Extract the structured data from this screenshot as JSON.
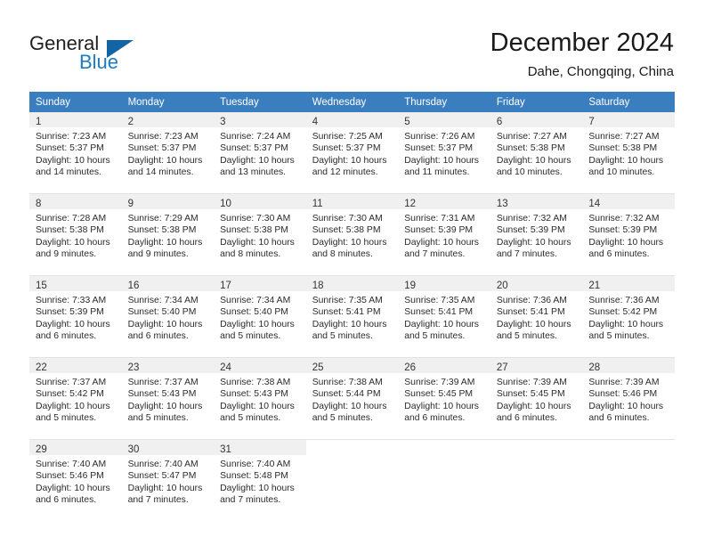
{
  "brand": {
    "name_part1": "General",
    "name_part2": "Blue",
    "logo_icon": "triangle-mark"
  },
  "header": {
    "title": "December 2024",
    "subtitle": "Dahe, Chongqing, China"
  },
  "calendar": {
    "weekday_headers": [
      "Sunday",
      "Monday",
      "Tuesday",
      "Wednesday",
      "Thursday",
      "Friday",
      "Saturday"
    ],
    "header_bg": "#3a7ebf",
    "daynum_bg": "#f0f0f0",
    "weeks": [
      [
        {
          "day": "1",
          "sunrise": "Sunrise: 7:23 AM",
          "sunset": "Sunset: 5:37 PM",
          "daylight1": "Daylight: 10 hours",
          "daylight2": "and 14 minutes."
        },
        {
          "day": "2",
          "sunrise": "Sunrise: 7:23 AM",
          "sunset": "Sunset: 5:37 PM",
          "daylight1": "Daylight: 10 hours",
          "daylight2": "and 14 minutes."
        },
        {
          "day": "3",
          "sunrise": "Sunrise: 7:24 AM",
          "sunset": "Sunset: 5:37 PM",
          "daylight1": "Daylight: 10 hours",
          "daylight2": "and 13 minutes."
        },
        {
          "day": "4",
          "sunrise": "Sunrise: 7:25 AM",
          "sunset": "Sunset: 5:37 PM",
          "daylight1": "Daylight: 10 hours",
          "daylight2": "and 12 minutes."
        },
        {
          "day": "5",
          "sunrise": "Sunrise: 7:26 AM",
          "sunset": "Sunset: 5:37 PM",
          "daylight1": "Daylight: 10 hours",
          "daylight2": "and 11 minutes."
        },
        {
          "day": "6",
          "sunrise": "Sunrise: 7:27 AM",
          "sunset": "Sunset: 5:38 PM",
          "daylight1": "Daylight: 10 hours",
          "daylight2": "and 10 minutes."
        },
        {
          "day": "7",
          "sunrise": "Sunrise: 7:27 AM",
          "sunset": "Sunset: 5:38 PM",
          "daylight1": "Daylight: 10 hours",
          "daylight2": "and 10 minutes."
        }
      ],
      [
        {
          "day": "8",
          "sunrise": "Sunrise: 7:28 AM",
          "sunset": "Sunset: 5:38 PM",
          "daylight1": "Daylight: 10 hours",
          "daylight2": "and 9 minutes."
        },
        {
          "day": "9",
          "sunrise": "Sunrise: 7:29 AM",
          "sunset": "Sunset: 5:38 PM",
          "daylight1": "Daylight: 10 hours",
          "daylight2": "and 9 minutes."
        },
        {
          "day": "10",
          "sunrise": "Sunrise: 7:30 AM",
          "sunset": "Sunset: 5:38 PM",
          "daylight1": "Daylight: 10 hours",
          "daylight2": "and 8 minutes."
        },
        {
          "day": "11",
          "sunrise": "Sunrise: 7:30 AM",
          "sunset": "Sunset: 5:38 PM",
          "daylight1": "Daylight: 10 hours",
          "daylight2": "and 8 minutes."
        },
        {
          "day": "12",
          "sunrise": "Sunrise: 7:31 AM",
          "sunset": "Sunset: 5:39 PM",
          "daylight1": "Daylight: 10 hours",
          "daylight2": "and 7 minutes."
        },
        {
          "day": "13",
          "sunrise": "Sunrise: 7:32 AM",
          "sunset": "Sunset: 5:39 PM",
          "daylight1": "Daylight: 10 hours",
          "daylight2": "and 7 minutes."
        },
        {
          "day": "14",
          "sunrise": "Sunrise: 7:32 AM",
          "sunset": "Sunset: 5:39 PM",
          "daylight1": "Daylight: 10 hours",
          "daylight2": "and 6 minutes."
        }
      ],
      [
        {
          "day": "15",
          "sunrise": "Sunrise: 7:33 AM",
          "sunset": "Sunset: 5:39 PM",
          "daylight1": "Daylight: 10 hours",
          "daylight2": "and 6 minutes."
        },
        {
          "day": "16",
          "sunrise": "Sunrise: 7:34 AM",
          "sunset": "Sunset: 5:40 PM",
          "daylight1": "Daylight: 10 hours",
          "daylight2": "and 6 minutes."
        },
        {
          "day": "17",
          "sunrise": "Sunrise: 7:34 AM",
          "sunset": "Sunset: 5:40 PM",
          "daylight1": "Daylight: 10 hours",
          "daylight2": "and 5 minutes."
        },
        {
          "day": "18",
          "sunrise": "Sunrise: 7:35 AM",
          "sunset": "Sunset: 5:41 PM",
          "daylight1": "Daylight: 10 hours",
          "daylight2": "and 5 minutes."
        },
        {
          "day": "19",
          "sunrise": "Sunrise: 7:35 AM",
          "sunset": "Sunset: 5:41 PM",
          "daylight1": "Daylight: 10 hours",
          "daylight2": "and 5 minutes."
        },
        {
          "day": "20",
          "sunrise": "Sunrise: 7:36 AM",
          "sunset": "Sunset: 5:41 PM",
          "daylight1": "Daylight: 10 hours",
          "daylight2": "and 5 minutes."
        },
        {
          "day": "21",
          "sunrise": "Sunrise: 7:36 AM",
          "sunset": "Sunset: 5:42 PM",
          "daylight1": "Daylight: 10 hours",
          "daylight2": "and 5 minutes."
        }
      ],
      [
        {
          "day": "22",
          "sunrise": "Sunrise: 7:37 AM",
          "sunset": "Sunset: 5:42 PM",
          "daylight1": "Daylight: 10 hours",
          "daylight2": "and 5 minutes."
        },
        {
          "day": "23",
          "sunrise": "Sunrise: 7:37 AM",
          "sunset": "Sunset: 5:43 PM",
          "daylight1": "Daylight: 10 hours",
          "daylight2": "and 5 minutes."
        },
        {
          "day": "24",
          "sunrise": "Sunrise: 7:38 AM",
          "sunset": "Sunset: 5:43 PM",
          "daylight1": "Daylight: 10 hours",
          "daylight2": "and 5 minutes."
        },
        {
          "day": "25",
          "sunrise": "Sunrise: 7:38 AM",
          "sunset": "Sunset: 5:44 PM",
          "daylight1": "Daylight: 10 hours",
          "daylight2": "and 5 minutes."
        },
        {
          "day": "26",
          "sunrise": "Sunrise: 7:39 AM",
          "sunset": "Sunset: 5:45 PM",
          "daylight1": "Daylight: 10 hours",
          "daylight2": "and 6 minutes."
        },
        {
          "day": "27",
          "sunrise": "Sunrise: 7:39 AM",
          "sunset": "Sunset: 5:45 PM",
          "daylight1": "Daylight: 10 hours",
          "daylight2": "and 6 minutes."
        },
        {
          "day": "28",
          "sunrise": "Sunrise: 7:39 AM",
          "sunset": "Sunset: 5:46 PM",
          "daylight1": "Daylight: 10 hours",
          "daylight2": "and 6 minutes."
        }
      ],
      [
        {
          "day": "29",
          "sunrise": "Sunrise: 7:40 AM",
          "sunset": "Sunset: 5:46 PM",
          "daylight1": "Daylight: 10 hours",
          "daylight2": "and 6 minutes."
        },
        {
          "day": "30",
          "sunrise": "Sunrise: 7:40 AM",
          "sunset": "Sunset: 5:47 PM",
          "daylight1": "Daylight: 10 hours",
          "daylight2": "and 7 minutes."
        },
        {
          "day": "31",
          "sunrise": "Sunrise: 7:40 AM",
          "sunset": "Sunset: 5:48 PM",
          "daylight1": "Daylight: 10 hours",
          "daylight2": "and 7 minutes."
        },
        {
          "day": "",
          "sunrise": "",
          "sunset": "",
          "daylight1": "",
          "daylight2": ""
        },
        {
          "day": "",
          "sunrise": "",
          "sunset": "",
          "daylight1": "",
          "daylight2": ""
        },
        {
          "day": "",
          "sunrise": "",
          "sunset": "",
          "daylight1": "",
          "daylight2": ""
        },
        {
          "day": "",
          "sunrise": "",
          "sunset": "",
          "daylight1": "",
          "daylight2": ""
        }
      ]
    ]
  }
}
